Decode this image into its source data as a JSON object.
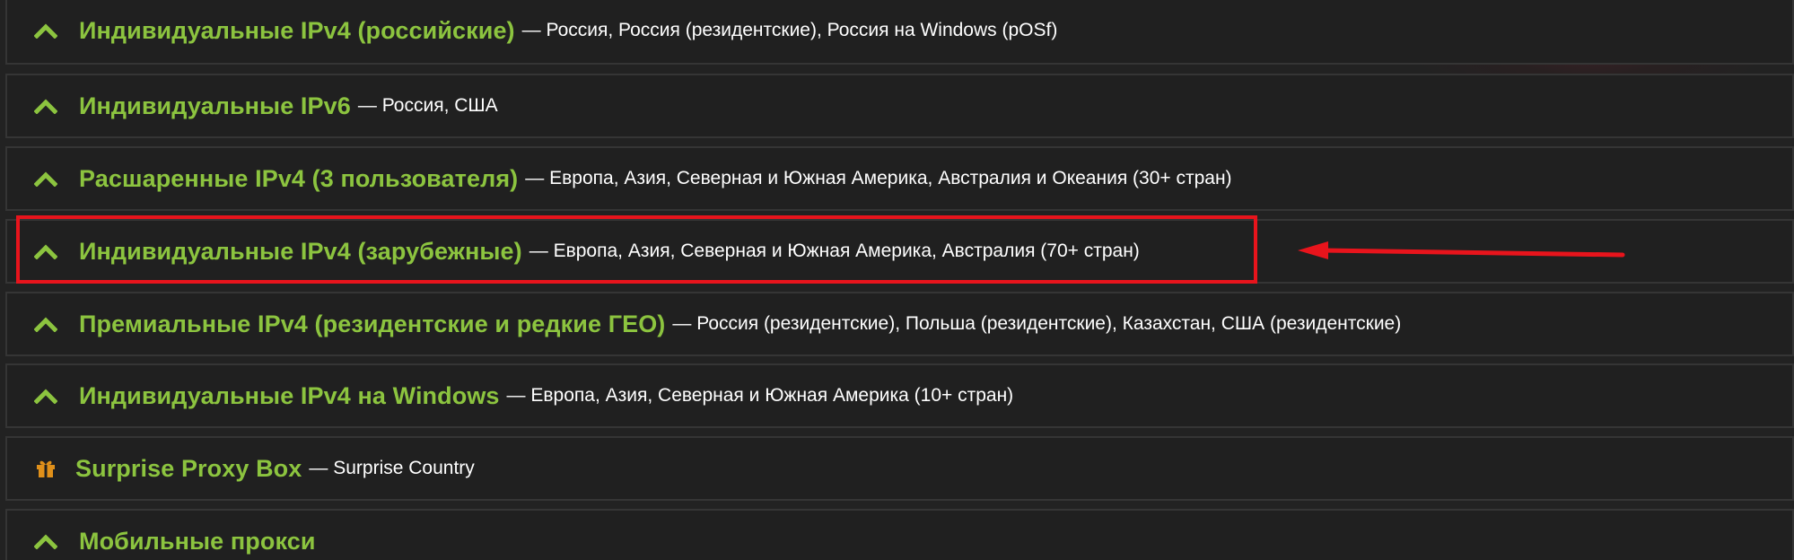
{
  "items": [
    {
      "title": "Индивидуальные IPv4 (российские)",
      "desc": "— Россия, Россия (резидентские), Россия на Windows (pOSf)",
      "icon": "chevron-up-icon"
    },
    {
      "title": "Индивидуальные IPv6",
      "desc": "— Россия, США",
      "icon": "chevron-up-icon"
    },
    {
      "title": "Расшаренные IPv4 (3 пользователя)",
      "desc": "— Европа, Азия, Северная и Южная Америка, Австралия и Океания (30+ стран)",
      "icon": "chevron-up-icon"
    },
    {
      "title": "Индивидуальные IPv4 (зарубежные)",
      "desc": "— Европа, Азия, Северная и Южная Америка, Австралия (70+ стран)",
      "icon": "chevron-up-icon"
    },
    {
      "title": "Премиальные IPv4 (резидентские и редкие ГЕО)",
      "desc": "— Россия (резидентские), Польша (резидентские), Казахстан, США (резидентские)",
      "icon": "chevron-up-icon"
    },
    {
      "title": "Индивидуальные IPv4 на Windows",
      "desc": "— Европа, Азия, Северная и Южная Америка (10+ стран)",
      "icon": "chevron-up-icon"
    },
    {
      "title": "Surprise Proxy Box",
      "desc": "— Surprise Country",
      "icon": "gift-icon"
    },
    {
      "title": "Мобильные прокси",
      "desc": "",
      "icon": "chevron-up-icon"
    }
  ],
  "colors": {
    "accent": "#8cc43f",
    "gift": "#e0901a",
    "highlight": "#e8141c",
    "background": "#222222"
  }
}
